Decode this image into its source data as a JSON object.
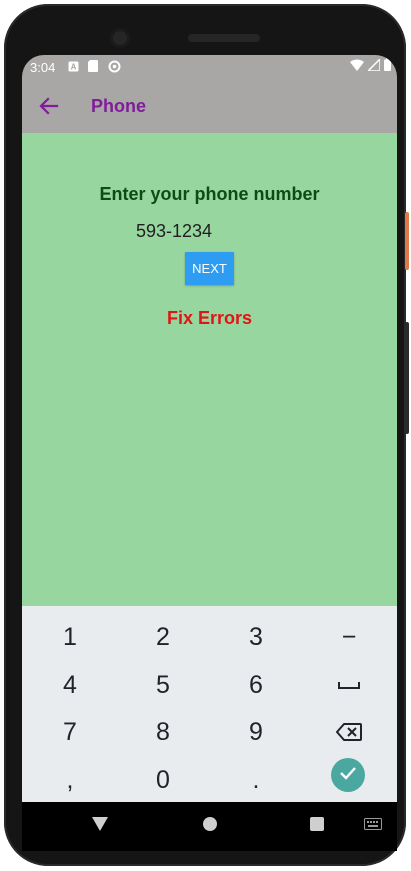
{
  "status_bar": {
    "time": "3:04"
  },
  "app_bar": {
    "title": "Phone"
  },
  "form": {
    "prompt": "Enter your phone number",
    "phone_value": "593-1234",
    "next_label": "NEXT",
    "error_message": "Fix Errors"
  },
  "keyboard": {
    "row1": [
      "1",
      "2",
      "3",
      "−"
    ],
    "row2": [
      "4",
      "5",
      "6"
    ],
    "row3": [
      "7",
      "8",
      "9"
    ],
    "row4": [
      ",",
      "0",
      "."
    ]
  },
  "colors": {
    "app_bar_bg": "#a9a6a6",
    "app_bar_title": "#7f1d9a",
    "content_bg": "#98d6a0",
    "prompt_text": "#0c4d12",
    "next_button": "#2e9cf0",
    "error_text": "#e01515",
    "keyboard_bg": "#e9ecef",
    "done_key": "#4aa8a0"
  },
  "icons": {
    "back": "arrow-left-icon",
    "space": "space-bar-icon",
    "backspace": "backspace-icon",
    "done": "checkmark-icon",
    "nav_back": "triangle-back-icon",
    "nav_home": "circle-home-icon",
    "nav_recents": "square-recents-icon",
    "nav_keyboard": "keyboard-icon"
  }
}
